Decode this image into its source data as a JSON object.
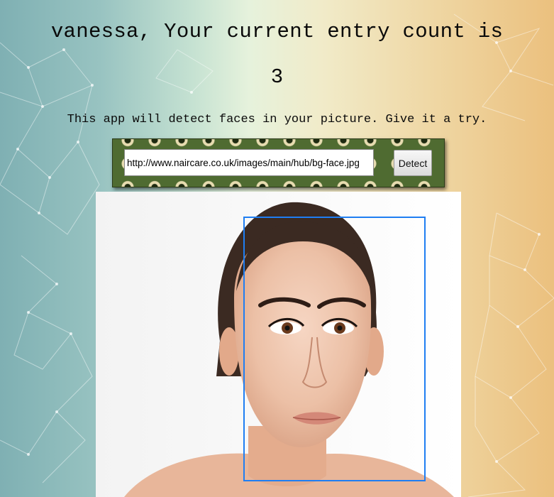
{
  "header": {
    "user_name": "vanessa",
    "title": "vanessa, Your current entry count is",
    "entry_count": "3"
  },
  "intro": {
    "description": "This app will detect faces in your picture. Give it a try."
  },
  "detect_form": {
    "url_value": "http://www.naircare.co.uk/images/main/hub/bg-face.jpg",
    "button_label": "Detect"
  },
  "result": {
    "faces_detected": 1,
    "box_color": "#1f7ef2"
  },
  "colors": {
    "bg_left": "#7fb0b3",
    "bg_center": "#e6f2dc",
    "bg_right": "#ebc07e",
    "form_bar": "#4f6b31"
  }
}
